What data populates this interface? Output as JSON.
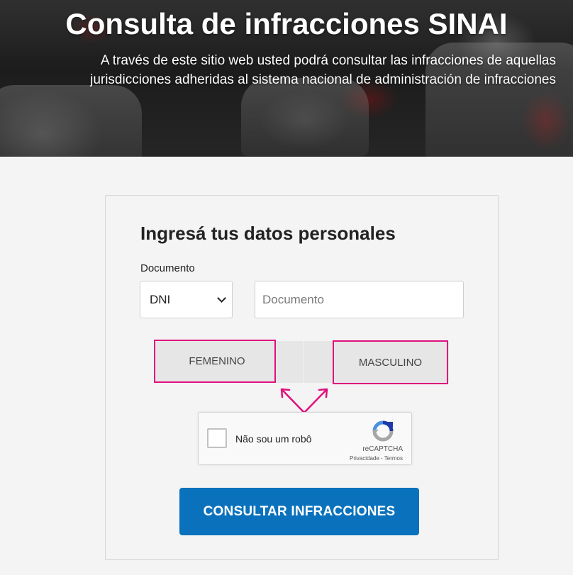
{
  "hero": {
    "title": "Consulta de infracciones SINAI",
    "subtitle": "A través de este sitio web usted podrá consultar las infracciones de aquellas jurisdicciones adheridas al sistema nacional de administración de infracciones"
  },
  "form": {
    "title": "Ingresá tus datos personales",
    "document_label": "Documento",
    "document_type_selected": "DNI",
    "document_placeholder": "Documento",
    "document_value": "",
    "gender_options": [
      "FEMENINO",
      "MASCULINO"
    ],
    "submit_label": "CONSULTAR INFRACCIONES"
  },
  "captcha": {
    "label": "Não sou um robô",
    "brand": "reCAPTCHA",
    "privacy": "Privacidade",
    "separator": " - ",
    "terms": "Termos",
    "checked": false,
    "logo_icon": "recaptcha-logo-icon"
  },
  "colors": {
    "primary_button": "#0a72bd",
    "highlight": "#e0107d",
    "gender_bg": "#e6e6e6",
    "page_bg": "#f4f4f4"
  }
}
